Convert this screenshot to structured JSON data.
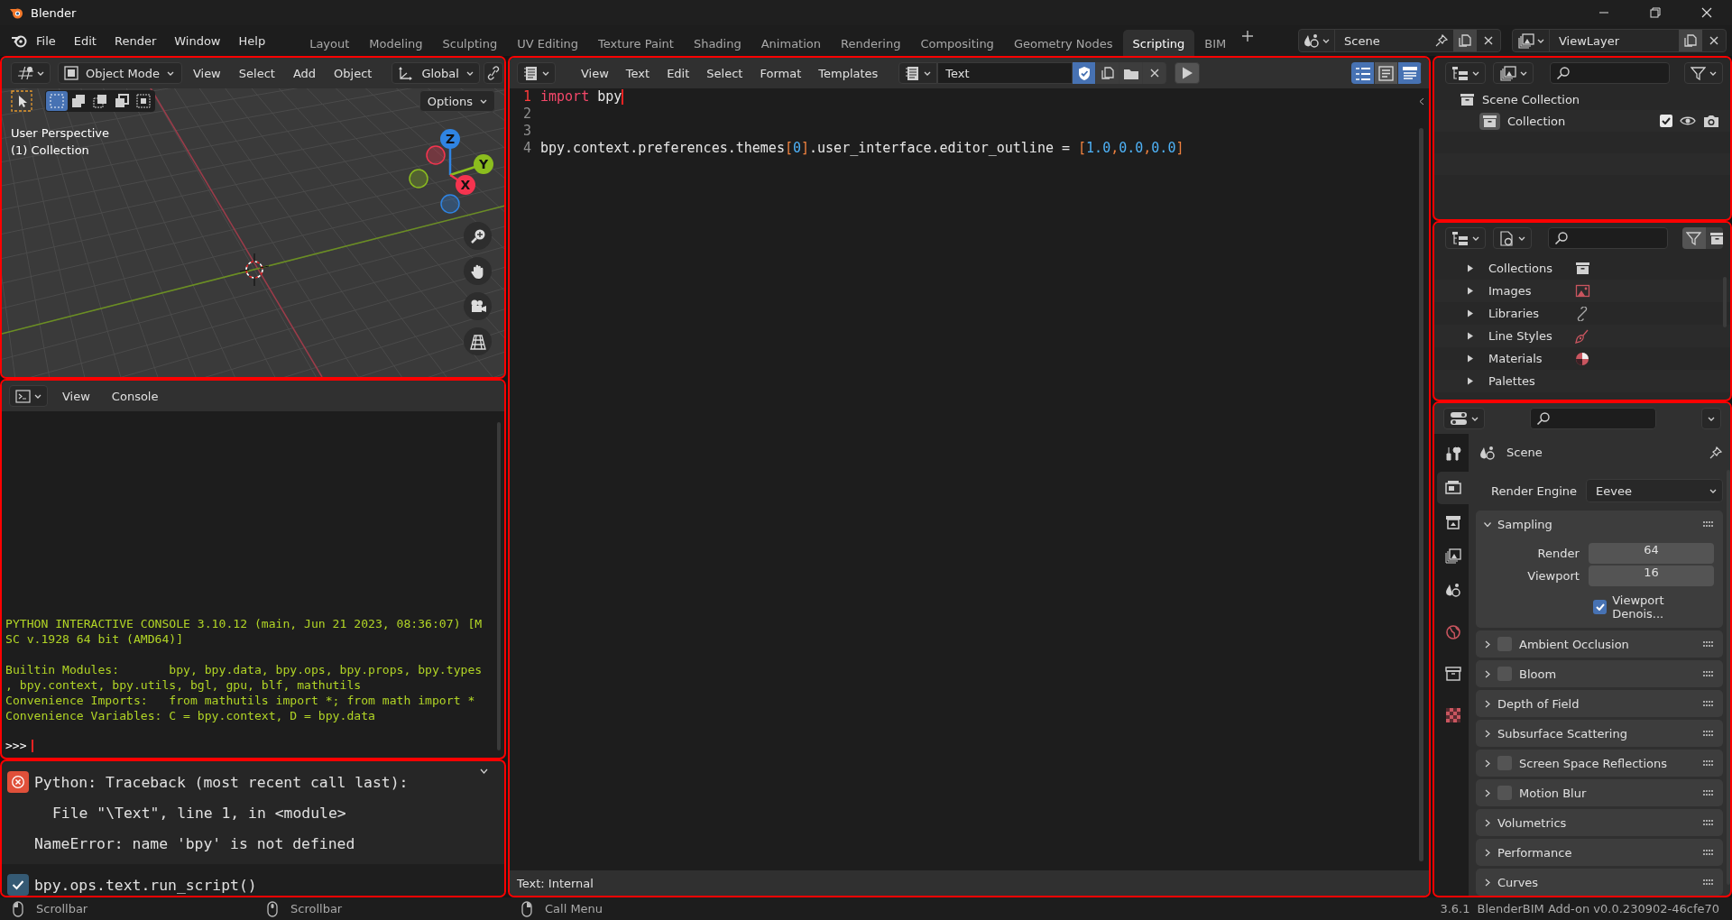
{
  "window": {
    "title": "Blender"
  },
  "menu": [
    "File",
    "Edit",
    "Render",
    "Window",
    "Help"
  ],
  "workspaces": [
    {
      "label": "Layout",
      "selected": false
    },
    {
      "label": "Modeling",
      "selected": false
    },
    {
      "label": "Sculpting",
      "selected": false
    },
    {
      "label": "UV Editing",
      "selected": false
    },
    {
      "label": "Texture Paint",
      "selected": false
    },
    {
      "label": "Shading",
      "selected": false
    },
    {
      "label": "Animation",
      "selected": false
    },
    {
      "label": "Rendering",
      "selected": false
    },
    {
      "label": "Compositing",
      "selected": false
    },
    {
      "label": "Geometry Nodes",
      "selected": false
    },
    {
      "label": "Scripting",
      "selected": true
    },
    {
      "label": "BIM",
      "selected": false
    }
  ],
  "scene": "Scene",
  "view_layer": "ViewLayer",
  "viewport": {
    "mode": "Object Mode",
    "menus": [
      "View",
      "Select",
      "Add",
      "Object"
    ],
    "orientation": "Global",
    "select_modes": [
      {
        "selected": true
      },
      {
        "selected": false
      },
      {
        "selected": false
      },
      {
        "selected": false
      },
      {
        "selected": false
      }
    ],
    "options": "Options",
    "overlay": [
      "User Perspective",
      "(1) Collection"
    ],
    "axes": [
      "Z",
      "Y",
      "X"
    ]
  },
  "console": {
    "menus": [
      "View",
      "Console"
    ],
    "blocks": [
      {
        "lines": [
          "PYTHON INTERACTIVE CONSOLE 3.10.12 (main, Jun 21 2023, 08:36:07) [M",
          "SC v.1928 64 bit (AMD64)]"
        ]
      },
      {
        "lines": [
          "Builtin Modules:       bpy, bpy.data, bpy.ops, bpy.props, bpy.types",
          ", bpy.context, bpy.utils, bgl, gpu, blf, mathutils",
          "Convenience Imports:   from mathutils import *; from math import *",
          "Convenience Variables: C = bpy.context, D = bpy.data"
        ]
      }
    ],
    "prompt": ">>>"
  },
  "info": {
    "reports": [
      {
        "kind": "error",
        "lines": [
          "Python: Traceback (most recent call last):",
          "File \"\\Text\", line 1, in <module>",
          "NameError: name 'bpy' is not defined"
        ]
      },
      {
        "kind": "operator",
        "lines": [
          "bpy.ops.text.run_script()"
        ]
      }
    ]
  },
  "text_editor": {
    "menus": [
      "View",
      "Text",
      "Edit",
      "Select",
      "Format",
      "Templates"
    ],
    "text_name": "Text",
    "toggles": [
      {
        "on": true
      },
      {
        "on": false
      },
      {
        "on": true
      }
    ],
    "lines": [
      {
        "number": "1",
        "current": true,
        "tokens": [
          {
            "kind": "keyword",
            "text": "import"
          },
          {
            "kind": "plain",
            "text": " bpy"
          }
        ]
      },
      {
        "number": "2",
        "current": false
      },
      {
        "number": "3",
        "current": false
      },
      {
        "number": "4",
        "current": false,
        "tokens": [
          {
            "kind": "plain",
            "text": "bpy.context.preferences.themes"
          },
          {
            "kind": "symbol",
            "text": "["
          },
          {
            "kind": "number",
            "text": "0"
          },
          {
            "kind": "symbol",
            "text": "]"
          },
          {
            "kind": "plain",
            "text": ".user_interface.editor_outline = "
          },
          {
            "kind": "symbol",
            "text": "["
          },
          {
            "kind": "number",
            "text": "1.0"
          },
          {
            "kind": "symbol",
            "text": ","
          },
          {
            "kind": "number",
            "text": "0.0"
          },
          {
            "kind": "symbol",
            "text": ","
          },
          {
            "kind": "number",
            "text": "0.0"
          },
          {
            "kind": "symbol",
            "text": "]"
          }
        ]
      }
    ],
    "footer": "Text: Internal"
  },
  "outliner": {
    "items": [
      {
        "label": "Scene Collection",
        "children": [
          {
            "label": "Collection",
            "checked": true
          }
        ]
      }
    ]
  },
  "blend_file": {
    "items": [
      {
        "label": "Collections",
        "expanded": false
      },
      {
        "label": "Images",
        "expanded": false
      },
      {
        "label": "Libraries",
        "expanded": false
      },
      {
        "label": "Line Styles",
        "expanded": false
      },
      {
        "label": "Materials",
        "expanded": false
      },
      {
        "label": "Palettes",
        "expanded": false
      }
    ]
  },
  "properties": {
    "tabs": [
      {
        "selected": false
      },
      {
        "selected": true
      },
      {
        "selected": false
      },
      {
        "selected": false
      },
      {
        "selected": false
      },
      {
        "selected": false
      },
      {
        "selected": false
      },
      {
        "selected": false
      }
    ],
    "context": "Scene",
    "render_engine": {
      "label": "Render Engine",
      "value": "Eevee"
    },
    "panels": [
      {
        "title": "Sampling",
        "kind": "plain",
        "expanded": true,
        "fields": [
          {
            "label": "Render",
            "value": "64"
          },
          {
            "label": "Viewport",
            "value": "16"
          }
        ],
        "option": {
          "label": "Viewport Denois...",
          "checked": true
        }
      },
      {
        "title": "Ambient Occlusion",
        "kind": "toggle",
        "checked": false,
        "expanded": false
      },
      {
        "title": "Bloom",
        "kind": "toggle",
        "checked": false,
        "expanded": false
      },
      {
        "title": "Depth of Field",
        "kind": "plain",
        "expanded": false
      },
      {
        "title": "Subsurface Scattering",
        "kind": "plain",
        "expanded": false
      },
      {
        "title": "Screen Space Reflections",
        "kind": "toggle",
        "checked": false,
        "expanded": false
      },
      {
        "title": "Motion Blur",
        "kind": "toggle",
        "checked": false,
        "expanded": false
      },
      {
        "title": "Volumetrics",
        "kind": "plain",
        "expanded": false
      },
      {
        "title": "Performance",
        "kind": "plain",
        "expanded": false
      },
      {
        "title": "Curves",
        "kind": "plain",
        "expanded": false
      }
    ]
  },
  "status_bar": {
    "hints": [
      "Scrollbar",
      "Scrollbar",
      "Call Menu"
    ],
    "version": "3.6.1",
    "addon": "BlenderBIM Add-on v0.0.230902-46cfe70"
  }
}
